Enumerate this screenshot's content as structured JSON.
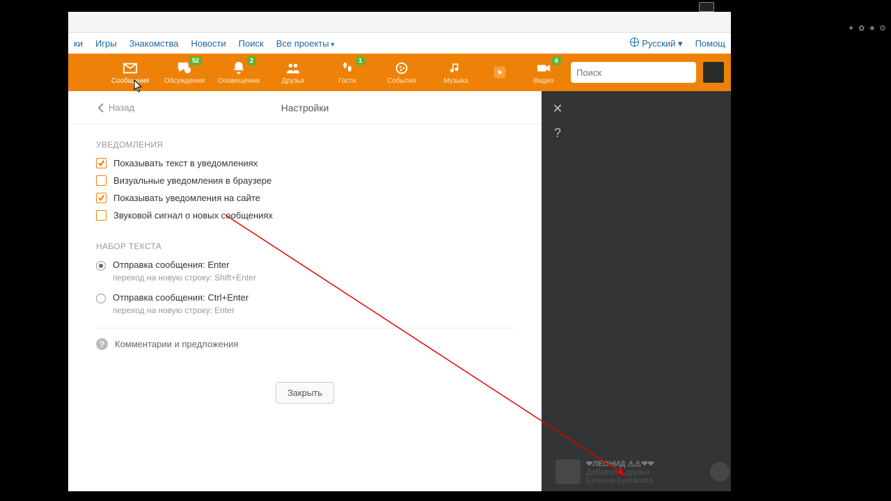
{
  "topnav": {
    "truncated": "ки",
    "items": [
      "Игры",
      "Знакомства",
      "Новости",
      "Поиск",
      "Все проекты"
    ],
    "language": "Русский",
    "help": "Помощ"
  },
  "orangebar": {
    "items": [
      {
        "key": "messages",
        "label": "Сообщения",
        "badge": null
      },
      {
        "key": "discussions",
        "label": "Обсуждения",
        "badge": "52"
      },
      {
        "key": "notifications",
        "label": "Оповещения",
        "badge": "2"
      },
      {
        "key": "friends",
        "label": "Друзья",
        "badge": null
      },
      {
        "key": "guests",
        "label": "Гости",
        "badge": "1"
      },
      {
        "key": "events",
        "label": "События",
        "badge": null
      },
      {
        "key": "music",
        "label": "Музыка",
        "badge": null
      },
      {
        "key": "play",
        "label": "",
        "badge": null
      },
      {
        "key": "video",
        "label": "Видео",
        "badge": "6"
      }
    ],
    "search_placeholder": "Поиск"
  },
  "panel": {
    "back": "Назад",
    "title": "Настройки",
    "section_notifications": "УВЕДОМЛЕНИЯ",
    "checks": [
      {
        "label": "Показывать текст в уведомлениях",
        "checked": true
      },
      {
        "label": "Визуальные уведомления в браузере",
        "checked": false
      },
      {
        "label": "Показывать уведомления на сайте",
        "checked": true
      },
      {
        "label": "Звуковой сигнал о новых сообщениях",
        "checked": false
      }
    ],
    "section_typing": "НАБОР ТЕКСТА",
    "radios": [
      {
        "label": "Отправка сообщения: Enter",
        "sub": "переход на новую строку: Shift+Enter",
        "selected": true
      },
      {
        "label": "Отправка сообщения: Ctrl+Enter",
        "sub": "переход на новую строку: Enter",
        "selected": false
      }
    ],
    "feedback": "Комментарии и предложения",
    "close": "Закрыть"
  },
  "side": {
    "close": "✕",
    "help": "?"
  },
  "friend_notif": {
    "name": "❤ЛЕОНИД ⚠⚠❤❤",
    "action": "Добавил в друзья",
    "who": "Евгения Булгакова"
  }
}
